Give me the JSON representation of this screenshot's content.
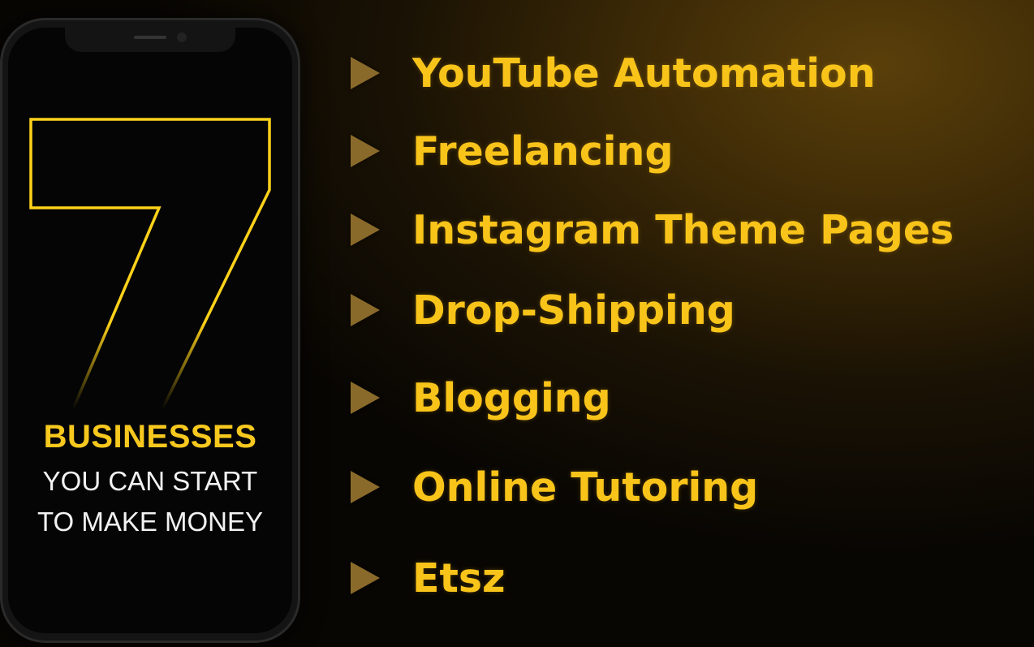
{
  "phone": {
    "big_number": "7",
    "line1": "BUSINESSES",
    "line2": "YOU CAN START",
    "line3": "TO MAKE MONEY"
  },
  "items": [
    {
      "label": "YouTube Automation"
    },
    {
      "label": "Freelancing"
    },
    {
      "label": "Instagram Theme Pages"
    },
    {
      "label": "Drop-Shipping"
    },
    {
      "label": "Blogging"
    },
    {
      "label": "Online Tutoring"
    },
    {
      "label": "Etsz"
    }
  ],
  "colors": {
    "accent": "#f9c41a",
    "arrow": "#8a6a2a",
    "phone_text": "#f2f2f2"
  },
  "icons": {
    "arrow": "play-triangle-icon"
  }
}
